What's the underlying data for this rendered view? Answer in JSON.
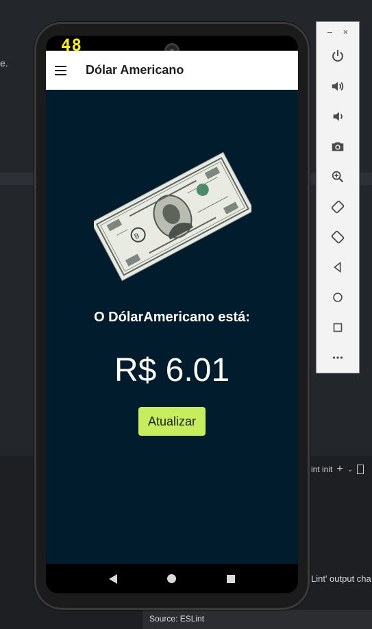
{
  "ide": {
    "edge_text": "e.",
    "panel_label": "int init",
    "plus": "+",
    "chevron": "⌄",
    "output_text": "Lint' output cha",
    "status_source": "Source: ESLint"
  },
  "emulator": {
    "minimize": "–",
    "close": "×",
    "tools": [
      {
        "name": "power-icon"
      },
      {
        "name": "volume-up-icon"
      },
      {
        "name": "volume-down-icon"
      },
      {
        "name": "camera-icon"
      },
      {
        "name": "zoom-icon"
      },
      {
        "name": "rotate-left-icon"
      },
      {
        "name": "rotate-right-icon"
      },
      {
        "name": "back-icon"
      },
      {
        "name": "home-icon"
      },
      {
        "name": "overview-icon"
      },
      {
        "name": "more-icon"
      }
    ]
  },
  "phone": {
    "fps": "48",
    "app_title": "Dólar Americano",
    "label": "O DólarAmericano está:",
    "price": "R$ 6.01",
    "button_label": "Atualizar"
  },
  "colors": {
    "screen_bg": "#011d2d",
    "button_bg": "#c6ee5c",
    "appbar_bg": "#ffffff"
  }
}
